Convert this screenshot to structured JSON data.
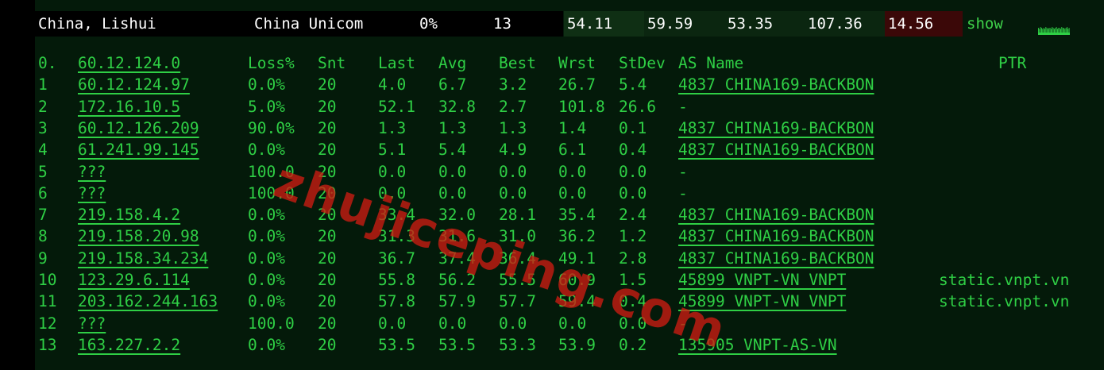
{
  "summary": {
    "location": "China, Lishui",
    "isp": "China Unicom",
    "loss": "0%",
    "hops": "13",
    "v1": "54.11",
    "v2": "59.59",
    "v3": "53.35",
    "v4": "107.36",
    "v5": "14.56",
    "show_label": "show"
  },
  "header": {
    "num": "0.",
    "host": "60.12.124.0",
    "loss": "Loss%",
    "snt": "Snt",
    "last": "Last",
    "avg": "Avg",
    "best": "Best",
    "wrst": "Wrst",
    "stdev": "StDev",
    "as": "AS Name",
    "ptr": "PTR"
  },
  "rows": [
    {
      "num": "1",
      "host": "60.12.124.97",
      "loss": "0.0%",
      "snt": "20",
      "last": "4.0",
      "avg": "6.7",
      "best": "3.2",
      "wrst": "26.7",
      "stdev": "5.4",
      "as": "4837  CHINA169-BACKBON",
      "ptr": ""
    },
    {
      "num": "2",
      "host": "172.16.10.5",
      "loss": "5.0%",
      "snt": "20",
      "last": "52.1",
      "avg": "32.8",
      "best": "2.7",
      "wrst": "101.8",
      "stdev": "26.6",
      "as": "-",
      "ptr": ""
    },
    {
      "num": "3",
      "host": "60.12.126.209",
      "loss": "90.0%",
      "snt": "20",
      "last": "1.3",
      "avg": "1.3",
      "best": "1.3",
      "wrst": "1.4",
      "stdev": "0.1",
      "as": "4837  CHINA169-BACKBON",
      "ptr": ""
    },
    {
      "num": "4",
      "host": "61.241.99.145",
      "loss": "0.0%",
      "snt": "20",
      "last": "5.1",
      "avg": "5.4",
      "best": "4.9",
      "wrst": "6.1",
      "stdev": "0.4",
      "as": "4837  CHINA169-BACKBON",
      "ptr": ""
    },
    {
      "num": "5",
      "host": "???",
      "loss": "100.0",
      "snt": "20",
      "last": "0.0",
      "avg": "0.0",
      "best": "0.0",
      "wrst": "0.0",
      "stdev": "0.0",
      "as": "-",
      "ptr": ""
    },
    {
      "num": "6",
      "host": "???",
      "loss": "100.0",
      "snt": "20",
      "last": "0.0",
      "avg": "0.0",
      "best": "0.0",
      "wrst": "0.0",
      "stdev": "0.0",
      "as": "-",
      "ptr": ""
    },
    {
      "num": "7",
      "host": "219.158.4.2",
      "loss": "0.0%",
      "snt": "20",
      "last": "33.4",
      "avg": "32.0",
      "best": "28.1",
      "wrst": "35.4",
      "stdev": "2.4",
      "as": "4837  CHINA169-BACKBON",
      "ptr": ""
    },
    {
      "num": "8",
      "host": "219.158.20.98",
      "loss": "0.0%",
      "snt": "20",
      "last": "31.3",
      "avg": "31.6",
      "best": "31.0",
      "wrst": "36.2",
      "stdev": "1.2",
      "as": "4837  CHINA169-BACKBON",
      "ptr": ""
    },
    {
      "num": "9",
      "host": "219.158.34.234",
      "loss": "0.0%",
      "snt": "20",
      "last": "36.7",
      "avg": "37.4",
      "best": "36.4",
      "wrst": "49.1",
      "stdev": "2.8",
      "as": "4837  CHINA169-BACKBON",
      "ptr": ""
    },
    {
      "num": "10",
      "host": "123.29.6.114",
      "loss": "0.0%",
      "snt": "20",
      "last": "55.8",
      "avg": "56.2",
      "best": "55.5",
      "wrst": "60.9",
      "stdev": "1.5",
      "as": "45899 VNPT-VN VNPT",
      "ptr": "static.vnpt.vn"
    },
    {
      "num": "11",
      "host": "203.162.244.163",
      "loss": "0.0%",
      "snt": "20",
      "last": "57.8",
      "avg": "57.9",
      "best": "57.7",
      "wrst": "59.4",
      "stdev": "0.4",
      "as": "45899 VNPT-VN VNPT",
      "ptr": "static.vnpt.vn"
    },
    {
      "num": "12",
      "host": "???",
      "loss": "100.0",
      "snt": "20",
      "last": "0.0",
      "avg": "0.0",
      "best": "0.0",
      "wrst": "0.0",
      "stdev": "0.0",
      "as": "-",
      "ptr": ""
    },
    {
      "num": "13",
      "host": "163.227.2.2",
      "loss": "0.0%",
      "snt": "20",
      "last": "53.5",
      "avg": "53.5",
      "best": "53.3",
      "wrst": "53.9",
      "stdev": "0.2",
      "as": "135905 VNPT-AS-VN",
      "ptr": ""
    }
  ],
  "sparkline": {
    "values": [
      5,
      4,
      6,
      5,
      4,
      5,
      4,
      6,
      5,
      4,
      5,
      5,
      4,
      6,
      5,
      4,
      5,
      6,
      4,
      5,
      5,
      4,
      6,
      5,
      5,
      4,
      5,
      6,
      4,
      5
    ]
  },
  "watermark": "zhujiceping.com",
  "colors": {
    "text_green": "#2fcf45",
    "background": "#041a0a",
    "watermark": "#cd1c12",
    "alert_bg": "#3b0808"
  }
}
